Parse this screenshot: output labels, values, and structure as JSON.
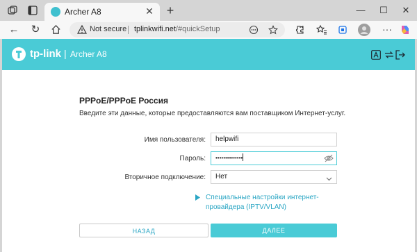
{
  "browser": {
    "tab": {
      "title": "Archer A8"
    },
    "address": {
      "security_label": "Not secure",
      "url_host": "tplinkwifi.net",
      "url_path": "/#quickSetup"
    }
  },
  "router": {
    "brand": "tp-link",
    "divider": "|",
    "model": "Archer A8"
  },
  "form": {
    "title": "PPPoE/PPPoE Россия",
    "subtitle": "Введите эти данные, которые предоставляются вам поставщиком Интернет-услуг.",
    "username": {
      "label": "Имя пользователя:",
      "value": "helpwifi"
    },
    "password": {
      "label": "Пароль:",
      "value": "••••••••••••••"
    },
    "secondary": {
      "label": "Вторичное подключение:",
      "value": "Нет"
    },
    "advanced_link": "Специальные настройки интернет-провайдера (IPTV/VLAN)",
    "back_button": "НАЗАД",
    "next_button": "ДАЛЕЕ"
  },
  "colors": {
    "accent": "#4acbd6",
    "link": "#2aa6c4",
    "header_text": "#ffffff"
  }
}
